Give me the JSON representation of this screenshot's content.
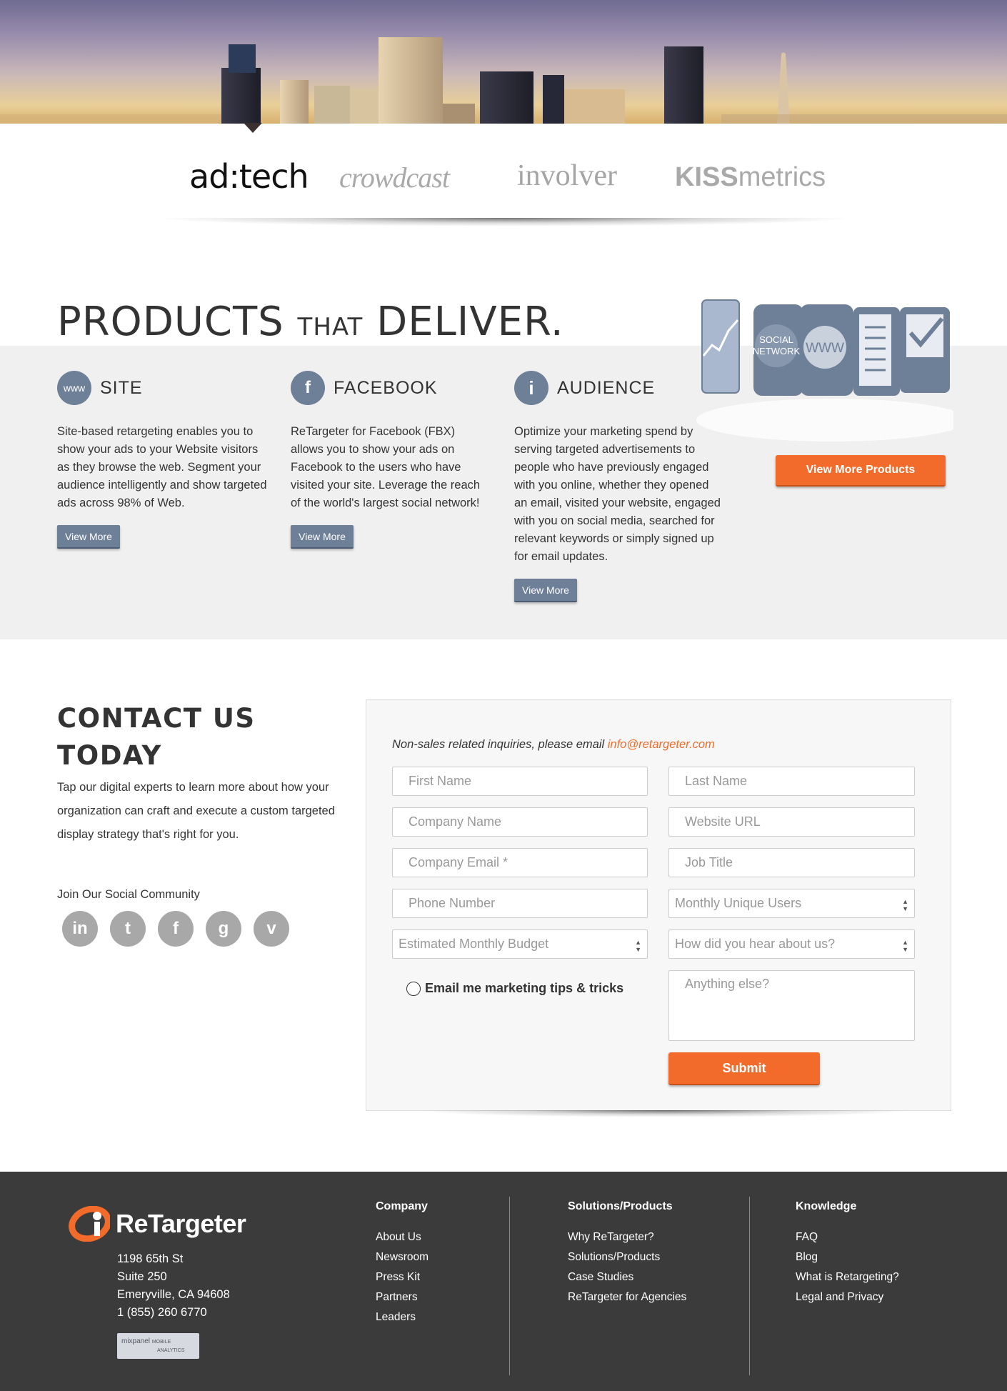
{
  "clients": {
    "adtech": "ad:tech",
    "crowdcast": "crowdcast",
    "involver": "involver",
    "kissmetrics_bold": "KISS",
    "kissmetrics_rest": "metrics"
  },
  "products": {
    "title_big1": "PRODUCTS",
    "title_small": "THAT",
    "title_big2": "DELIVER.",
    "graphic_labels": [
      "SOCIAL NETWORK",
      "WWW"
    ],
    "items": [
      {
        "icon": "www",
        "name": "SITE",
        "text": "Site-based retargeting enables you to show your ads to your Website visitors as they browse the web. Segment your audience intelligently and show targeted ads across 98% of Web.",
        "button": "View More"
      },
      {
        "icon": "f",
        "name": "FACEBOOK",
        "text": "ReTargeter for Facebook (FBX) allows you to show your ads on Facebook to the users who have visited your site. Leverage the reach of the world's largest social network!",
        "button": "View More"
      },
      {
        "icon": "i",
        "name": "AUDIENCE",
        "text": "Optimize your marketing spend by serving targeted advertisements to people who have previously engaged with you online, whether they opened an email, visited your website, engaged with you on social media, searched for relevant keywords or simply signed up for email updates.",
        "button": "View More"
      }
    ],
    "more_button": "View More Products"
  },
  "contact": {
    "title_line1": "CONTACT US",
    "title_line2": "TODAY",
    "text": "Tap our digital experts to learn more about how your organization can craft and execute a custom targeted display strategy that's right for you.",
    "social_title": "Join Our Social Community",
    "social_icons": [
      "linkedin-icon",
      "twitter-icon",
      "facebook-icon",
      "google-icon",
      "vimeo-icon"
    ],
    "social_glyphs": [
      "in",
      "t",
      "f",
      "g",
      "v"
    ]
  },
  "form": {
    "note": "Non-sales related inquiries, please email",
    "email": "info@retargeter.com",
    "first_name": "First Name",
    "last_name": "Last Name",
    "company_name": "Company Name",
    "website_url": "Website URL",
    "company_email": "Company Email *",
    "job_title": "Job Title",
    "phone": "Phone Number",
    "monthly_users": "Monthly Unique Users",
    "budget": "Estimated Monthly Budget",
    "hear_about": "How did you hear about us?",
    "checkbox_label": "Email me marketing tips & tricks",
    "anything_else": "Anything else?",
    "submit": "Submit"
  },
  "footer": {
    "brand": "ReTargeter",
    "address": [
      "1198 65th St",
      "Suite 250",
      "Emeryville, CA 94608",
      "1 (855) 260 6770"
    ],
    "mixpanel_line1": "mixpanel",
    "mixpanel_line2": "MOBILE",
    "mixpanel_line3": "ANALYTICS",
    "columns": [
      {
        "title": "Company",
        "links": [
          "About Us",
          "Newsroom",
          "Press Kit",
          "Partners",
          "Leaders"
        ]
      },
      {
        "title": "Solutions/Products",
        "links": [
          "Why ReTargeter?",
          "Solutions/Products",
          "Case Studies",
          "ReTargeter for Agencies"
        ]
      },
      {
        "title": "Knowledge",
        "links": [
          "FAQ",
          "Blog",
          "What is Retargeting?",
          "Legal and Privacy"
        ]
      }
    ]
  },
  "colors": {
    "accent": "#f26b2a",
    "steel": "#6e7f98",
    "footer_bg": "#3b3b3b",
    "band_bg": "#f0f0f0"
  }
}
